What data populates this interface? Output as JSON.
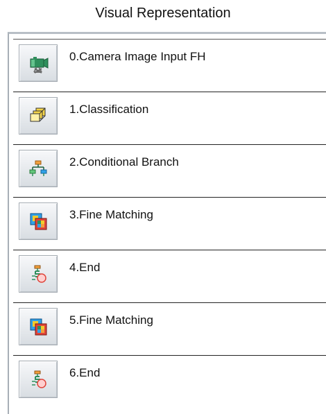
{
  "title": "Visual Representation",
  "flow": {
    "items": [
      {
        "label": "0.Camera Image Input FH",
        "icon": "camera-input-icon"
      },
      {
        "label": "1.Classification",
        "icon": "classification-icon"
      },
      {
        "label": "2.Conditional Branch",
        "icon": "conditional-branch-icon"
      },
      {
        "label": "3.Fine Matching",
        "icon": "fine-matching-icon"
      },
      {
        "label": "4.End",
        "icon": "end-icon"
      },
      {
        "label": "5.Fine Matching",
        "icon": "fine-matching-icon"
      },
      {
        "label": "6.End",
        "icon": "end-icon"
      }
    ]
  },
  "colors": {
    "icon_green": "#2f8f5c",
    "icon_yellow": "#f2cb2d",
    "icon_orange": "#f29f3d",
    "icon_cyan": "#31a2e8",
    "icon_red": "#e0443a"
  }
}
